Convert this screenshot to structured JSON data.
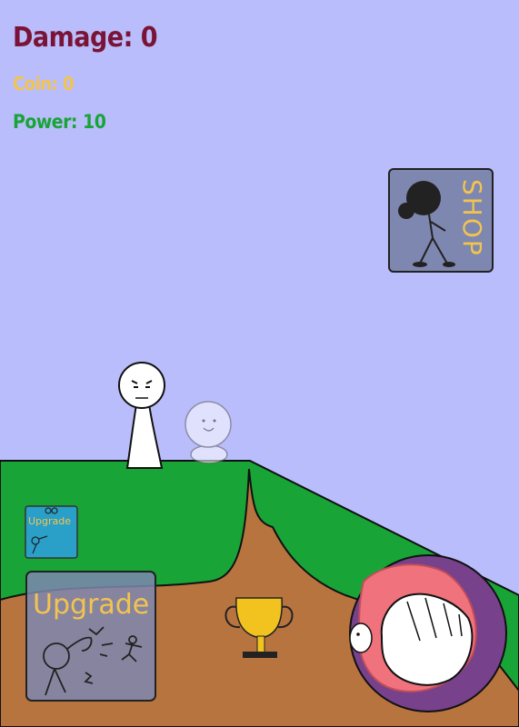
{
  "hud": {
    "damage_label": "Damage: 0",
    "coin_label": "Coin: 0",
    "power_label": "Power: 10"
  },
  "colors": {
    "sky": "#babdfb",
    "grass": "#18a437",
    "dirt": "#b8743f",
    "damage": "#7a1437",
    "coin": "#f2c44e",
    "power": "#18a437",
    "button_panel": "#7e87b0",
    "upgrade_small_bg": "#2aa0c8",
    "punch_ring": "#77418b"
  },
  "buttons": {
    "shop_label": "SHOP",
    "upgrade_label": "Upgrade",
    "upgrade_small_label": "Upgrade"
  },
  "icons": [
    "stickman-shop-icon",
    "trophy-icon",
    "punch-fist-icon",
    "stickman-kick-icon"
  ]
}
